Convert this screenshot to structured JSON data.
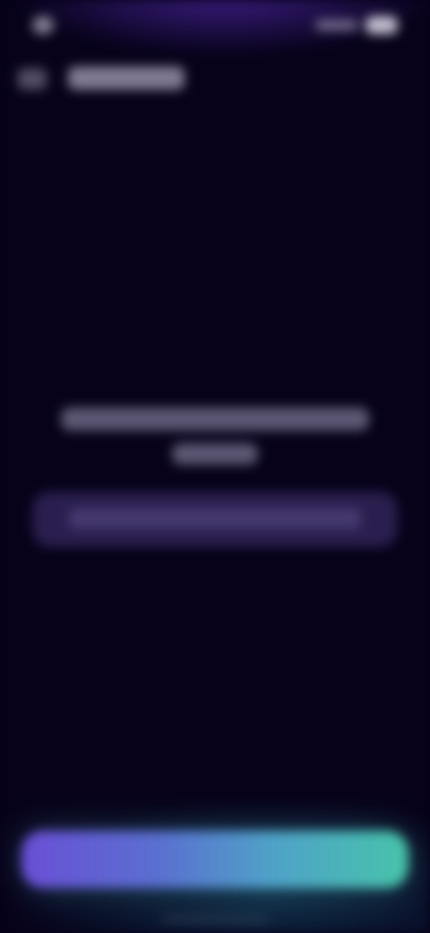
{
  "status_bar": {
    "time": "",
    "signal_icon": "signal-icon",
    "battery_icon": "battery-icon"
  },
  "header": {
    "back_icon": "back-arrow-icon",
    "title": ""
  },
  "message": {
    "line1": "",
    "line2": ""
  },
  "info_pill": {
    "text": ""
  },
  "primary_button": {
    "label": "",
    "gradient_start": "#6a4fd6",
    "gradient_end": "#47c4aa"
  },
  "colors": {
    "background": "#07021a",
    "accent_glow": "#5028aa"
  }
}
